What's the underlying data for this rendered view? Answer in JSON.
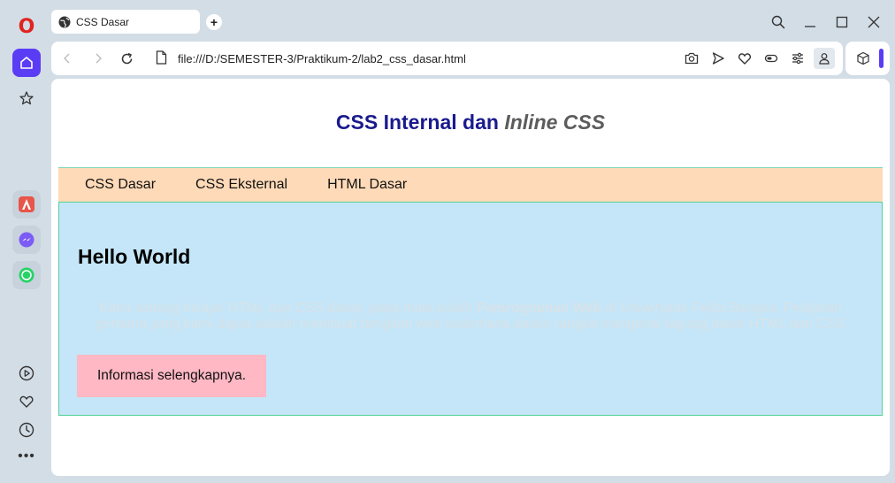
{
  "browser": {
    "tab_title": "CSS Dasar",
    "new_tab_label": "+",
    "url": "file:///D:/SEMESTER-3/Praktikum-2/lab2_css_dasar.html",
    "brand_color": "#5b3cf5",
    "logo_char": "O",
    "more_label": "•••"
  },
  "page": {
    "title_part1": "CSS Internal dan ",
    "title_italic": "Inline CSS",
    "menu": [
      "CSS Dasar",
      "CSS Eksternal",
      "HTML Dasar"
    ],
    "heading": "Hello World",
    "paragraph": {
      "text1": "Kami sedang belajar HTML dan CSS dasar, pada mata kuliah ",
      "bold": "Pemrograman Web",
      "text2": " di ",
      "italic": "Universitas Pelita Bangsa",
      "text3": ". Pelajaran pertama yang kami dapat adalah membuat tampilan web sederhana dalam rangka mengenal tag-tag dasar HTML dan CSS"
    },
    "info_button": "Informasi selengkapnya.",
    "colors": {
      "menu_bg": "#ffdab8",
      "panel_bg": "#c4e6f8",
      "button_bg": "#ffb8c4",
      "title_color": "#1a1a8e"
    }
  }
}
